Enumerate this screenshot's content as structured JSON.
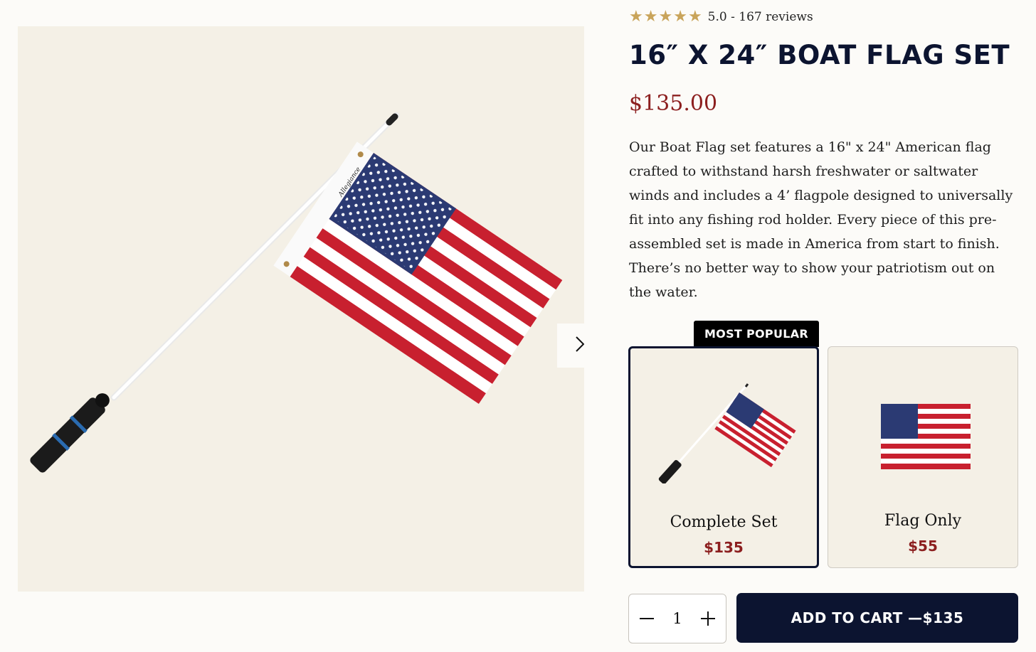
{
  "rating": {
    "stars": 5,
    "text": "5.0 - 167 reviews",
    "star_color": "#c9a45a"
  },
  "product": {
    "title": "16″ X 24″ BOAT FLAG SET",
    "price": "$135.00",
    "description": "Our Boat Flag set features a 16\" x 24\" American flag crafted to withstand harsh freshwater or saltwater winds and includes a 4’ flagpole designed to universally fit into any fishing rod holder. Every piece of this pre-assembled set is made in America from start to finish. There’s no better way to show your patriotism out on the water.",
    "image_brand_label": "Allegiance"
  },
  "options": {
    "badge": "MOST POPULAR",
    "items": [
      {
        "name": "Complete Set",
        "price": "$135",
        "selected": true
      },
      {
        "name": "Flag Only",
        "price": "$55",
        "selected": false
      }
    ]
  },
  "quantity": {
    "value": "1"
  },
  "cart": {
    "label": "ADD TO CART —$135"
  },
  "colors": {
    "navy": "#0c1430",
    "price_red": "#8c1f1f",
    "flag_red": "#c8202f",
    "flag_blue": "#2b3a73",
    "background": "#f4f0e6"
  },
  "icons": {
    "next": "chevron-right-icon",
    "minus": "minus-icon",
    "plus": "plus-icon",
    "star": "star-icon"
  }
}
